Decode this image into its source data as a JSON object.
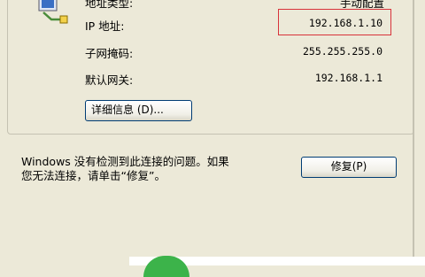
{
  "connection": {
    "address_type_label": "地址类型:",
    "address_type_value": "手动配置",
    "ip_label": "IP 地址:",
    "ip_value": "192.168.1.10",
    "mask_label": "子网掩码:",
    "mask_value": "255.255.255.0",
    "gateway_label": "默认网关:",
    "gateway_value": "192.168.1.1",
    "details_button": "详细信息 (D)..."
  },
  "repair": {
    "message_line1": "Windows 没有检测到此连接的问题。如果",
    "message_line2": "您无法连接，请单击“修复”。",
    "button": "修复(P)"
  },
  "colors": {
    "highlight_box": "#d8333a",
    "button_border": "#003c74"
  },
  "icons": [
    "network-connection-icon"
  ]
}
